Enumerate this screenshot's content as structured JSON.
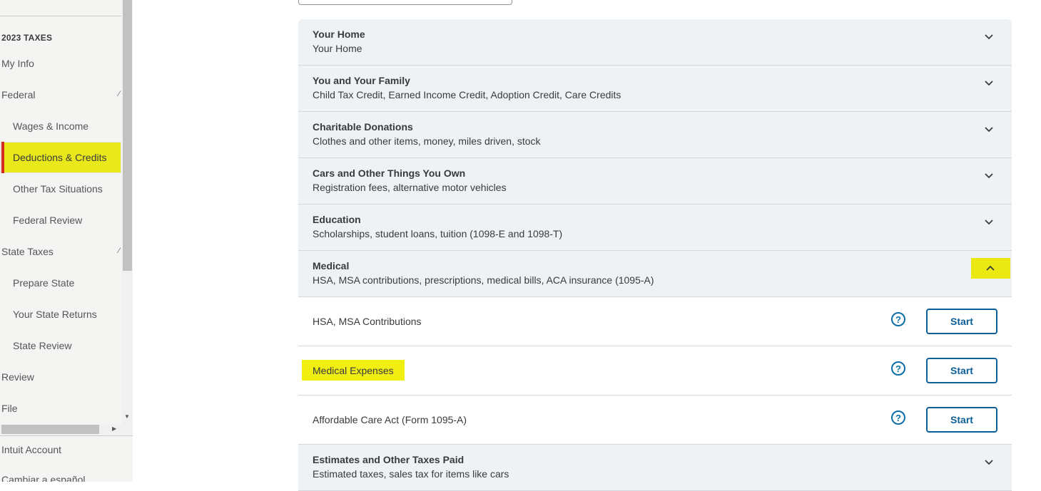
{
  "sidebar": {
    "section_title": "2023 TAXES",
    "items": [
      {
        "label": "My Info"
      },
      {
        "label": "Federal"
      },
      {
        "label": "Wages & Income"
      },
      {
        "label": "Deductions & Credits"
      },
      {
        "label": "Other Tax Situations"
      },
      {
        "label": "Federal Review"
      },
      {
        "label": "State Taxes"
      },
      {
        "label": "Prepare State"
      },
      {
        "label": "Your State Returns"
      },
      {
        "label": "State Review"
      },
      {
        "label": "Review"
      },
      {
        "label": "File"
      }
    ],
    "account_label": "Intuit Account",
    "language_label": "Cambiar a español"
  },
  "colors": {
    "highlight": "#eaea12",
    "active_bar": "#d52b1e",
    "primary_blue": "#0d5f97",
    "row_bg": "#eff2f5"
  },
  "accordion": [
    {
      "title": "Your Home",
      "sub": "Your Home",
      "icon": "chevron-down-icon"
    },
    {
      "title": "You and Your Family",
      "sub": "Child Tax Credit, Earned Income Credit, Adoption Credit, Care Credits",
      "icon": "chevron-down-icon"
    },
    {
      "title": "Charitable Donations",
      "sub": "Clothes and other items, money, miles driven, stock",
      "icon": "chevron-down-icon"
    },
    {
      "title": "Cars and Other Things You Own",
      "sub": "Registration fees, alternative motor vehicles",
      "icon": "chevron-down-icon"
    },
    {
      "title": "Education",
      "sub": "Scholarships, student loans, tuition (1098-E and 1098-T)",
      "icon": "chevron-down-icon"
    },
    {
      "title": "Medical",
      "sub": "HSA, MSA contributions, prescriptions, medical bills, ACA insurance (1095-A)",
      "icon": "chevron-up-icon"
    },
    {
      "title": "Estimates and Other Taxes Paid",
      "sub": "Estimated taxes, sales tax for items like cars",
      "icon": "chevron-down-icon"
    }
  ],
  "medical_items": [
    {
      "label": "HSA, MSA Contributions",
      "help": "?",
      "button": "Start"
    },
    {
      "label": "Medical Expenses",
      "help": "?",
      "button": "Start"
    },
    {
      "label": "Affordable Care Act (Form 1095-A)",
      "help": "?",
      "button": "Start"
    }
  ]
}
